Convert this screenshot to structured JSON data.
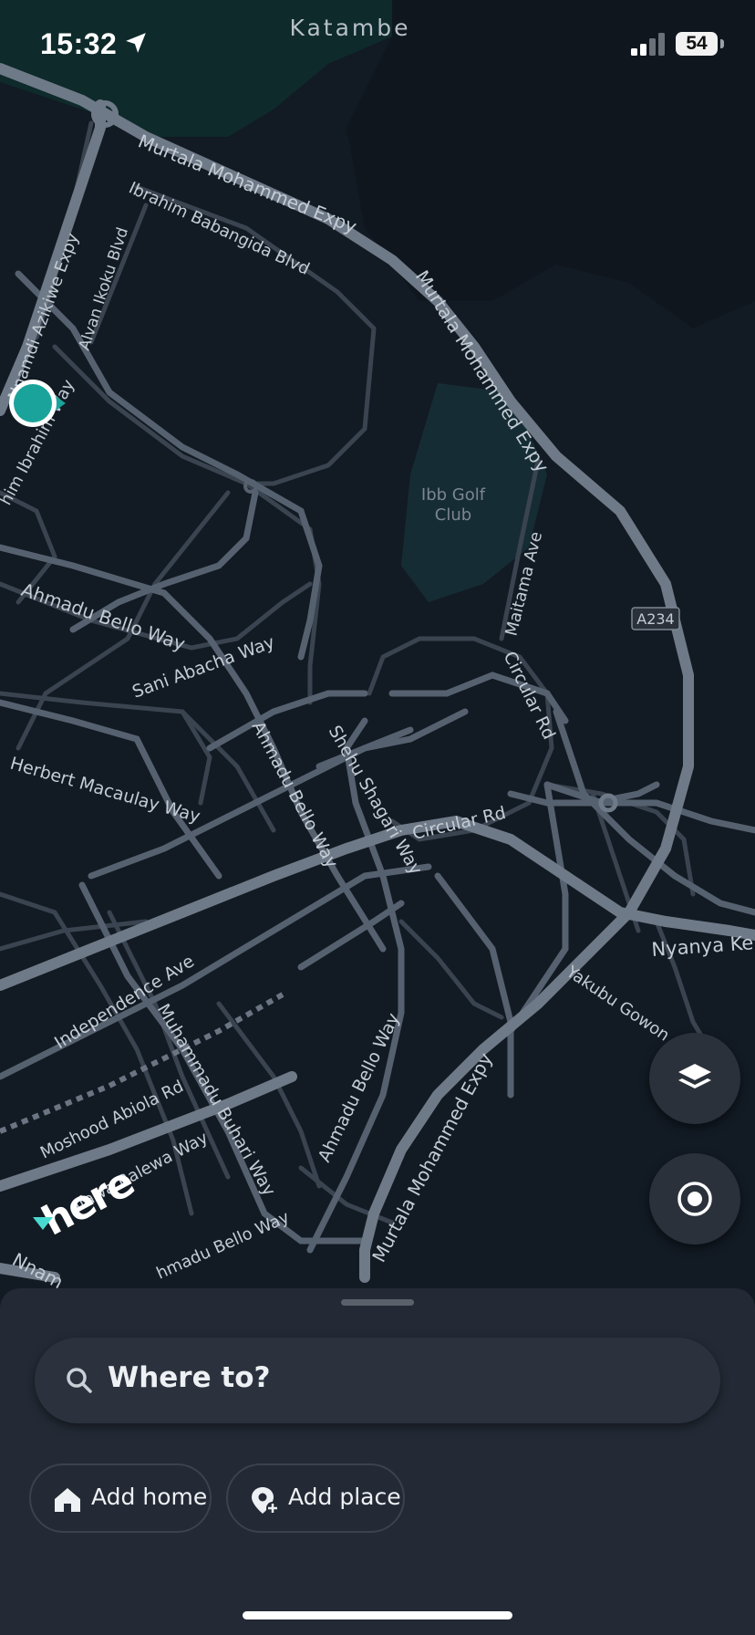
{
  "status_bar": {
    "time": "15:32",
    "location_label": "Katambe",
    "battery": "54"
  },
  "map": {
    "area_label": "Ibb Golf Club",
    "area_label_line1": "Ibb Golf",
    "area_label_line2": "Club",
    "road_badge": "A234",
    "roads": [
      "Murtala Mohammed Expy",
      "Ibrahim Babangida Blvd",
      "Nnamdi Azikiwe Expy",
      "Alvan Ikoku Blvd",
      "Ibrahim Way",
      "Ahmadu Bello Way",
      "Sani Abacha Way",
      "Herbert Macaulay Way",
      "Shehu Shagari Way",
      "Circular Rd",
      "Maitama Ave",
      "Independence Ave",
      "Muhammadu Buhari Way",
      "Moshood Abiola Rd",
      "Tafawa Balewa Way",
      "Yakubu Gowon",
      "Nyanya Ke"
    ],
    "labels": {
      "murtala_1": "Murtala Mohammed Expy",
      "murtala_2": "Murtala Mohammed Expy",
      "murtala_3": "Murtala Mohammed Expy",
      "ibrahim_babangida": "Ibrahim Babangida Blvd",
      "nnamdi": "Nnamdi Azikiwe Expy",
      "alvan": "Alvan Ikoku Blvd",
      "ibrahim_way": "him Ibrahim Way",
      "ahmadu_1": "Ahmadu Bello Way",
      "ahmadu_2": "Ahmadu Bello Way",
      "ahmadu_3": "Ahmadu Bello Way",
      "ahmadu_4": "hmadu Bello Way",
      "sani": "Sani Abacha Way",
      "herbert": "Herbert Macaulay Way",
      "shehu": "Shehu Shagari Way",
      "circular_1": "Circular Rd",
      "circular_2": "Circular Rd",
      "maitama": "Maitama Ave",
      "independence": "Independence Ave",
      "buhari": "Muhammadu Buhari Way",
      "moshood": "Moshood Abiola Rd",
      "tafawa": "afawa Balewa Way",
      "yakubu": "Yakubu Gowon",
      "nyanya": "Nyanya Ke",
      "nnam_bottom": "Nnam"
    },
    "logo_text": "here"
  },
  "controls": {
    "layers_icon": "layers-icon",
    "locate_icon": "locate-icon"
  },
  "sheet": {
    "search_placeholder": "Where to?",
    "chips": [
      {
        "label": "Add home",
        "icon": "home-icon"
      },
      {
        "label": "Add place",
        "icon": "add-place-icon"
      }
    ]
  },
  "colors": {
    "background": "#121a23",
    "road": "#5b6673",
    "accent": "#1aa39a",
    "sheet": "#232a35"
  }
}
